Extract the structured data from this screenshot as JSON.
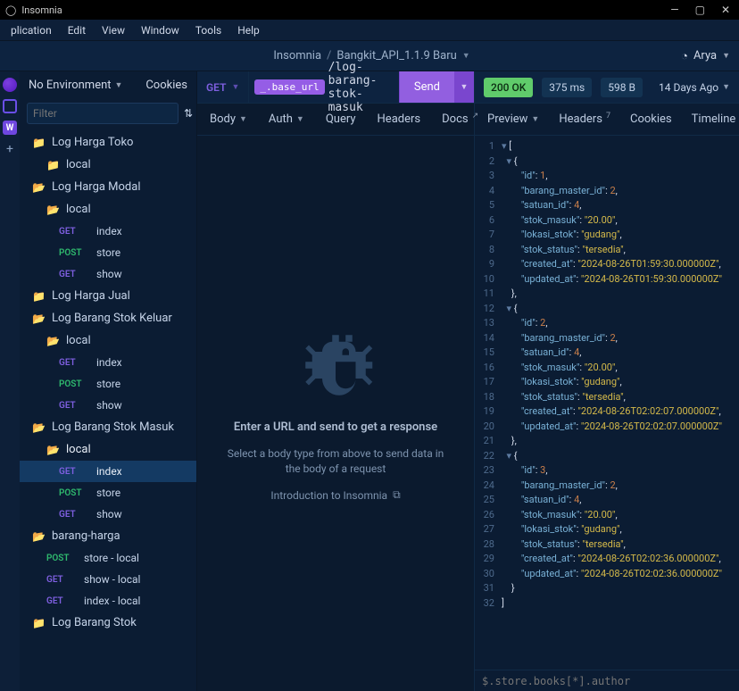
{
  "appName": "Insomnia",
  "menubar": {
    "application": "plication",
    "edit": "Edit",
    "view": "View",
    "window": "Window",
    "tools": "Tools",
    "help": "Help"
  },
  "breadcrumb": {
    "root": "Insomnia",
    "project": "Bangkit_API_1.1.9 Baru"
  },
  "user": {
    "name": "Arya"
  },
  "sidebar": {
    "environment": "No Environment",
    "cookies": "Cookies",
    "filterPlaceholder": "Filter",
    "tree": {
      "f0": "Log Harga Toko",
      "f0_local": "local",
      "f1": "Log Harga Modal",
      "f1_local": "local",
      "f1_index": "index",
      "f1_store": "store",
      "f1_show": "show",
      "f2": "Log Harga Jual",
      "f3": "Log Barang Stok Keluar",
      "f3_local": "local",
      "f3_index": "index",
      "f3_store": "store",
      "f3_show": "show",
      "f4": "Log Barang Stok Masuk",
      "f4_local": "local",
      "f4_index": "index",
      "f4_store": "store",
      "f4_show": "show",
      "f5": "barang-harga",
      "f5_storelocal": "store - local",
      "f5_showlocal": "show - local",
      "f5_indexlocal": "index - local",
      "f6": "Log Barang Stok"
    }
  },
  "request": {
    "method": "GET",
    "urlTag": "_.base_url",
    "urlPath": "/log-barang-stok-masuk",
    "send": "Send",
    "tabs": {
      "body": "Body",
      "auth": "Auth",
      "query": "Query",
      "headers": "Headers",
      "docs": "Docs"
    }
  },
  "centerBody": {
    "title": "Enter a URL and send to get a response",
    "subtitle": "Select a body type from above to send data in the body of a request",
    "intro": "Introduction to Insomnia"
  },
  "response": {
    "status": "200 OK",
    "time": "375 ms",
    "size": "598 B",
    "age": "14 Days Ago",
    "tabs": {
      "preview": "Preview",
      "headers": "Headers",
      "headersBadge": "7",
      "cookies": "Cookies",
      "timeline": "Timeline"
    },
    "filterPlaceholder": "$.store.books[*].author"
  },
  "chart_data": {
    "type": "table",
    "json_body": [
      {
        "id": 1,
        "barang_master_id": 2,
        "satuan_id": 4,
        "stok_masuk": "20.00",
        "lokasi_stok": "gudang",
        "stok_status": "tersedia",
        "created_at": "2024-08-26T01:59:30.000000Z",
        "updated_at": "2024-08-26T01:59:30.000000Z"
      },
      {
        "id": 2,
        "barang_master_id": 2,
        "satuan_id": 4,
        "stok_masuk": "20.00",
        "lokasi_stok": "gudang",
        "stok_status": "tersedia",
        "created_at": "2024-08-26T02:02:07.000000Z",
        "updated_at": "2024-08-26T02:02:07.000000Z"
      },
      {
        "id": 3,
        "barang_master_id": 2,
        "satuan_id": 4,
        "stok_masuk": "20.00",
        "lokasi_stok": "gudang",
        "stok_status": "tersedia",
        "created_at": "2024-08-26T02:02:36.000000Z",
        "updated_at": "2024-08-26T02:02:36.000000Z"
      }
    ]
  }
}
